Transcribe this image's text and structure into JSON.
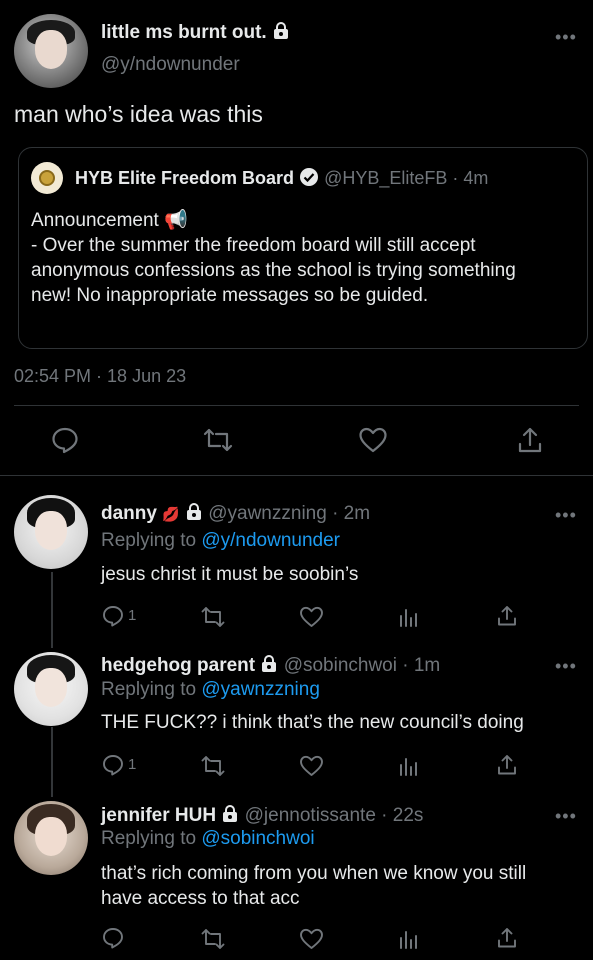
{
  "main_tweet": {
    "display_name": "little ms burnt out.",
    "handle": "@y/ndownunder",
    "text": "man who’s idea was this",
    "timestamp": "02:54 PM · 18 Jun 23"
  },
  "quoted_tweet": {
    "display_name": "HYB Elite Freedom Board",
    "handle": "@HYB_EliteFB · 4m",
    "line1": "Announcement 📢",
    "body": "- Over the summer the freedom board will still accept anonymous confessions as the school is trying something new! No inappropriate messages so be guided."
  },
  "replies": [
    {
      "display_name": "danny",
      "handle_time": "@yawnzzning · 2m",
      "replying_prefix": "Replying to ",
      "replying_to": "@y/ndownunder",
      "text": "jesus christ it must be soobin’s",
      "reply_count": "1"
    },
    {
      "display_name": "hedgehog parent",
      "handle_time": "@sobinchwoi · 1m",
      "replying_prefix": "Replying to ",
      "replying_to": "@yawnzzning",
      "text": "THE FUCK?? i think that’s the new council’s doing",
      "reply_count": "1"
    },
    {
      "display_name": "jennifer HUH",
      "handle_time": "@jennotissante · 22s",
      "replying_prefix": "Replying to ",
      "replying_to": "@sobinchwoi",
      "text": "that’s rich coming from you when we know you still have access to that acc",
      "reply_count": ""
    }
  ],
  "colors": {
    "background": "#000000",
    "text": "#e7e9ea",
    "muted": "#71767b",
    "link": "#1d9bf0",
    "verified": "#e7e9ea"
  }
}
